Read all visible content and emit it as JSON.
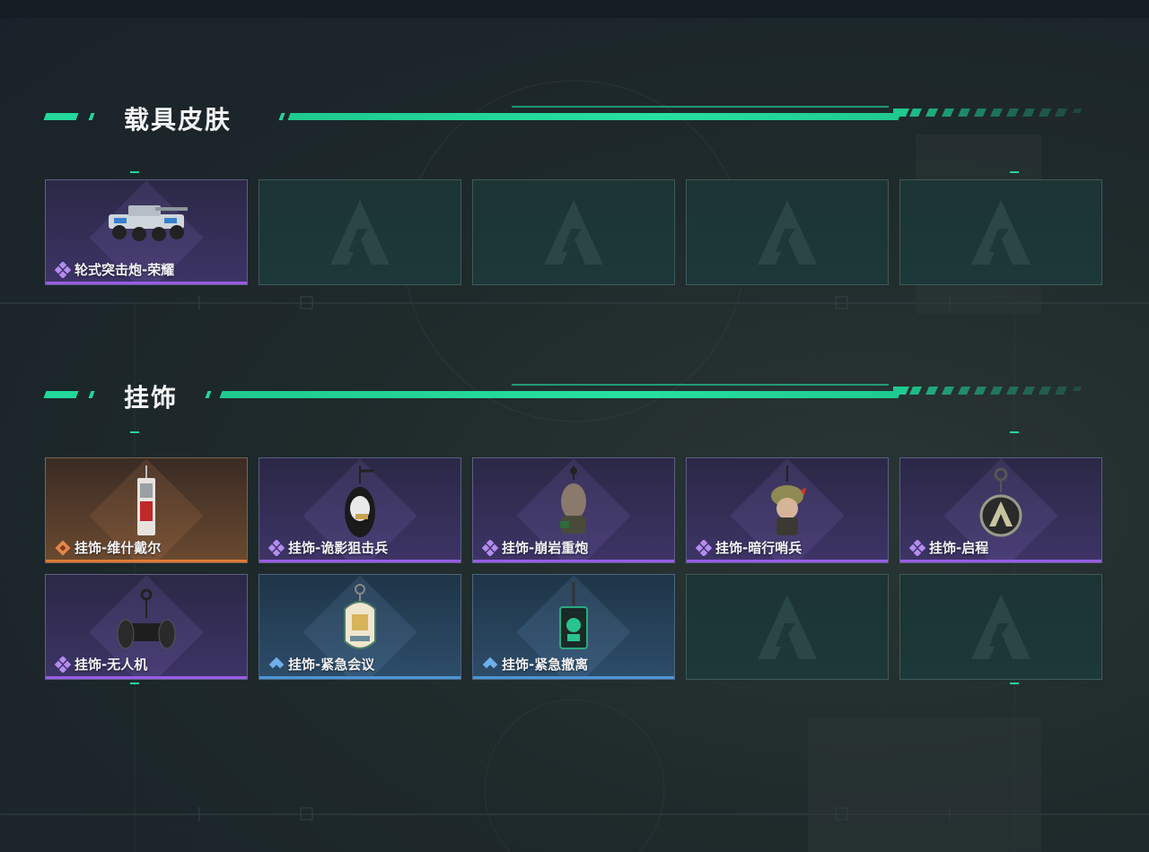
{
  "sections": {
    "vehicle_skins": {
      "title": "载具皮肤",
      "items": [
        {
          "name": "轮式突击炮-荣耀",
          "rarity": "purple",
          "icon": "armored-vehicle-icon"
        },
        {
          "empty": true
        },
        {
          "empty": true
        },
        {
          "empty": true
        },
        {
          "empty": true
        }
      ]
    },
    "charms": {
      "title": "挂饰",
      "items": [
        {
          "name": "挂饰-维什戴尔",
          "rarity": "orange",
          "icon": "charm-card-icon"
        },
        {
          "name": "挂饰-诡影狙击兵",
          "rarity": "purple",
          "icon": "charm-sniper-icon"
        },
        {
          "name": "挂饰-崩岩重炮",
          "rarity": "purple",
          "icon": "charm-heavy-gunner-icon"
        },
        {
          "name": "挂饰-暗行哨兵",
          "rarity": "purple",
          "icon": "charm-sentry-icon"
        },
        {
          "name": "挂饰-启程",
          "rarity": "purple",
          "icon": "charm-medallion-icon"
        },
        {
          "name": "挂饰-无人机",
          "rarity": "purple",
          "icon": "charm-drone-icon"
        },
        {
          "name": "挂饰-紧急会议",
          "rarity": "blue",
          "icon": "charm-badge-icon"
        },
        {
          "name": "挂饰-紧急撤离",
          "rarity": "blue",
          "icon": "charm-tag-icon"
        },
        {
          "empty": true
        },
        {
          "empty": true
        }
      ]
    }
  },
  "colors": {
    "accent": "#23d79a",
    "purple": "#9a5ce6",
    "orange": "#e07a36",
    "blue": "#4d95d6"
  }
}
